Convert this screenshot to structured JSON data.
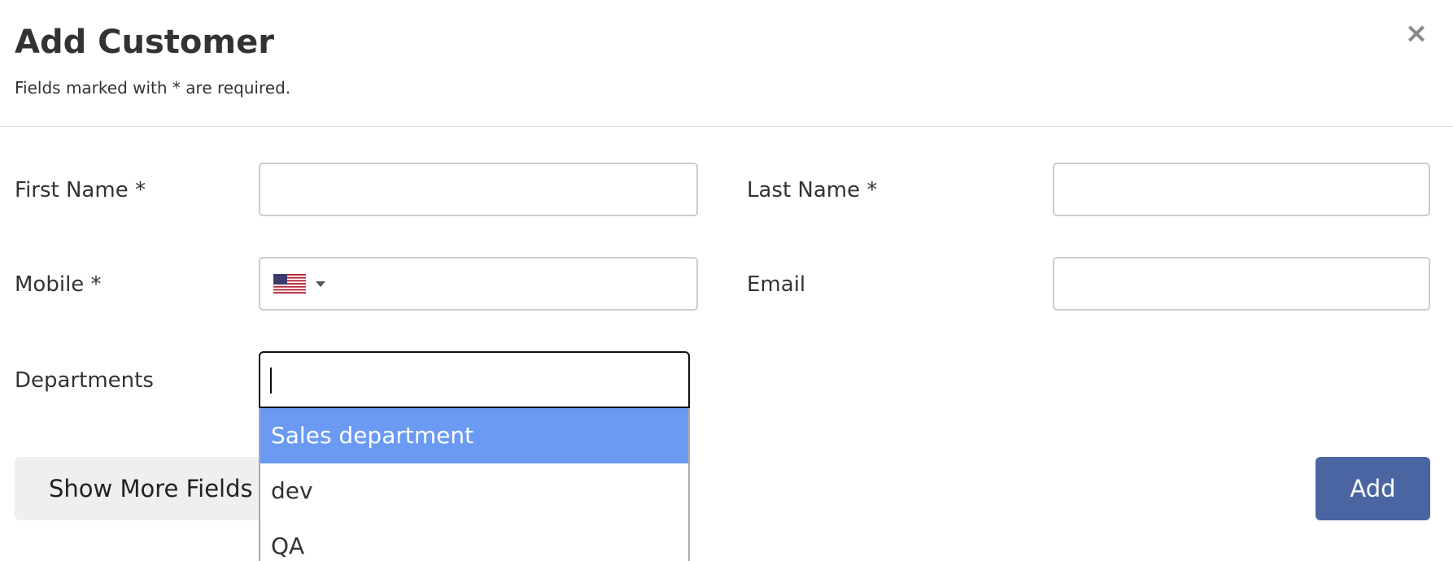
{
  "header": {
    "title": "Add Customer",
    "subtitle": "Fields marked with * are required.",
    "close_icon": "close-icon",
    "close_glyph": "×"
  },
  "form": {
    "first_name": {
      "label": "First Name *",
      "value": "",
      "placeholder": ""
    },
    "last_name": {
      "label": "Last Name *",
      "value": "",
      "placeholder": ""
    },
    "mobile": {
      "label": "Mobile *",
      "value": "",
      "placeholder": "",
      "country_flag": "us-flag-icon"
    },
    "email": {
      "label": "Email",
      "value": "",
      "placeholder": ""
    },
    "departments": {
      "label": "Departments",
      "value": "",
      "options": [
        "Sales department",
        "dev",
        "QA"
      ],
      "highlighted_option": "Sales department"
    }
  },
  "actions": {
    "show_more_label": "Show More Fields",
    "add_label": "Add"
  },
  "colors": {
    "primary_button": "#4a65a2",
    "highlight": "#6a9af1",
    "secondary_button": "#efefef"
  }
}
